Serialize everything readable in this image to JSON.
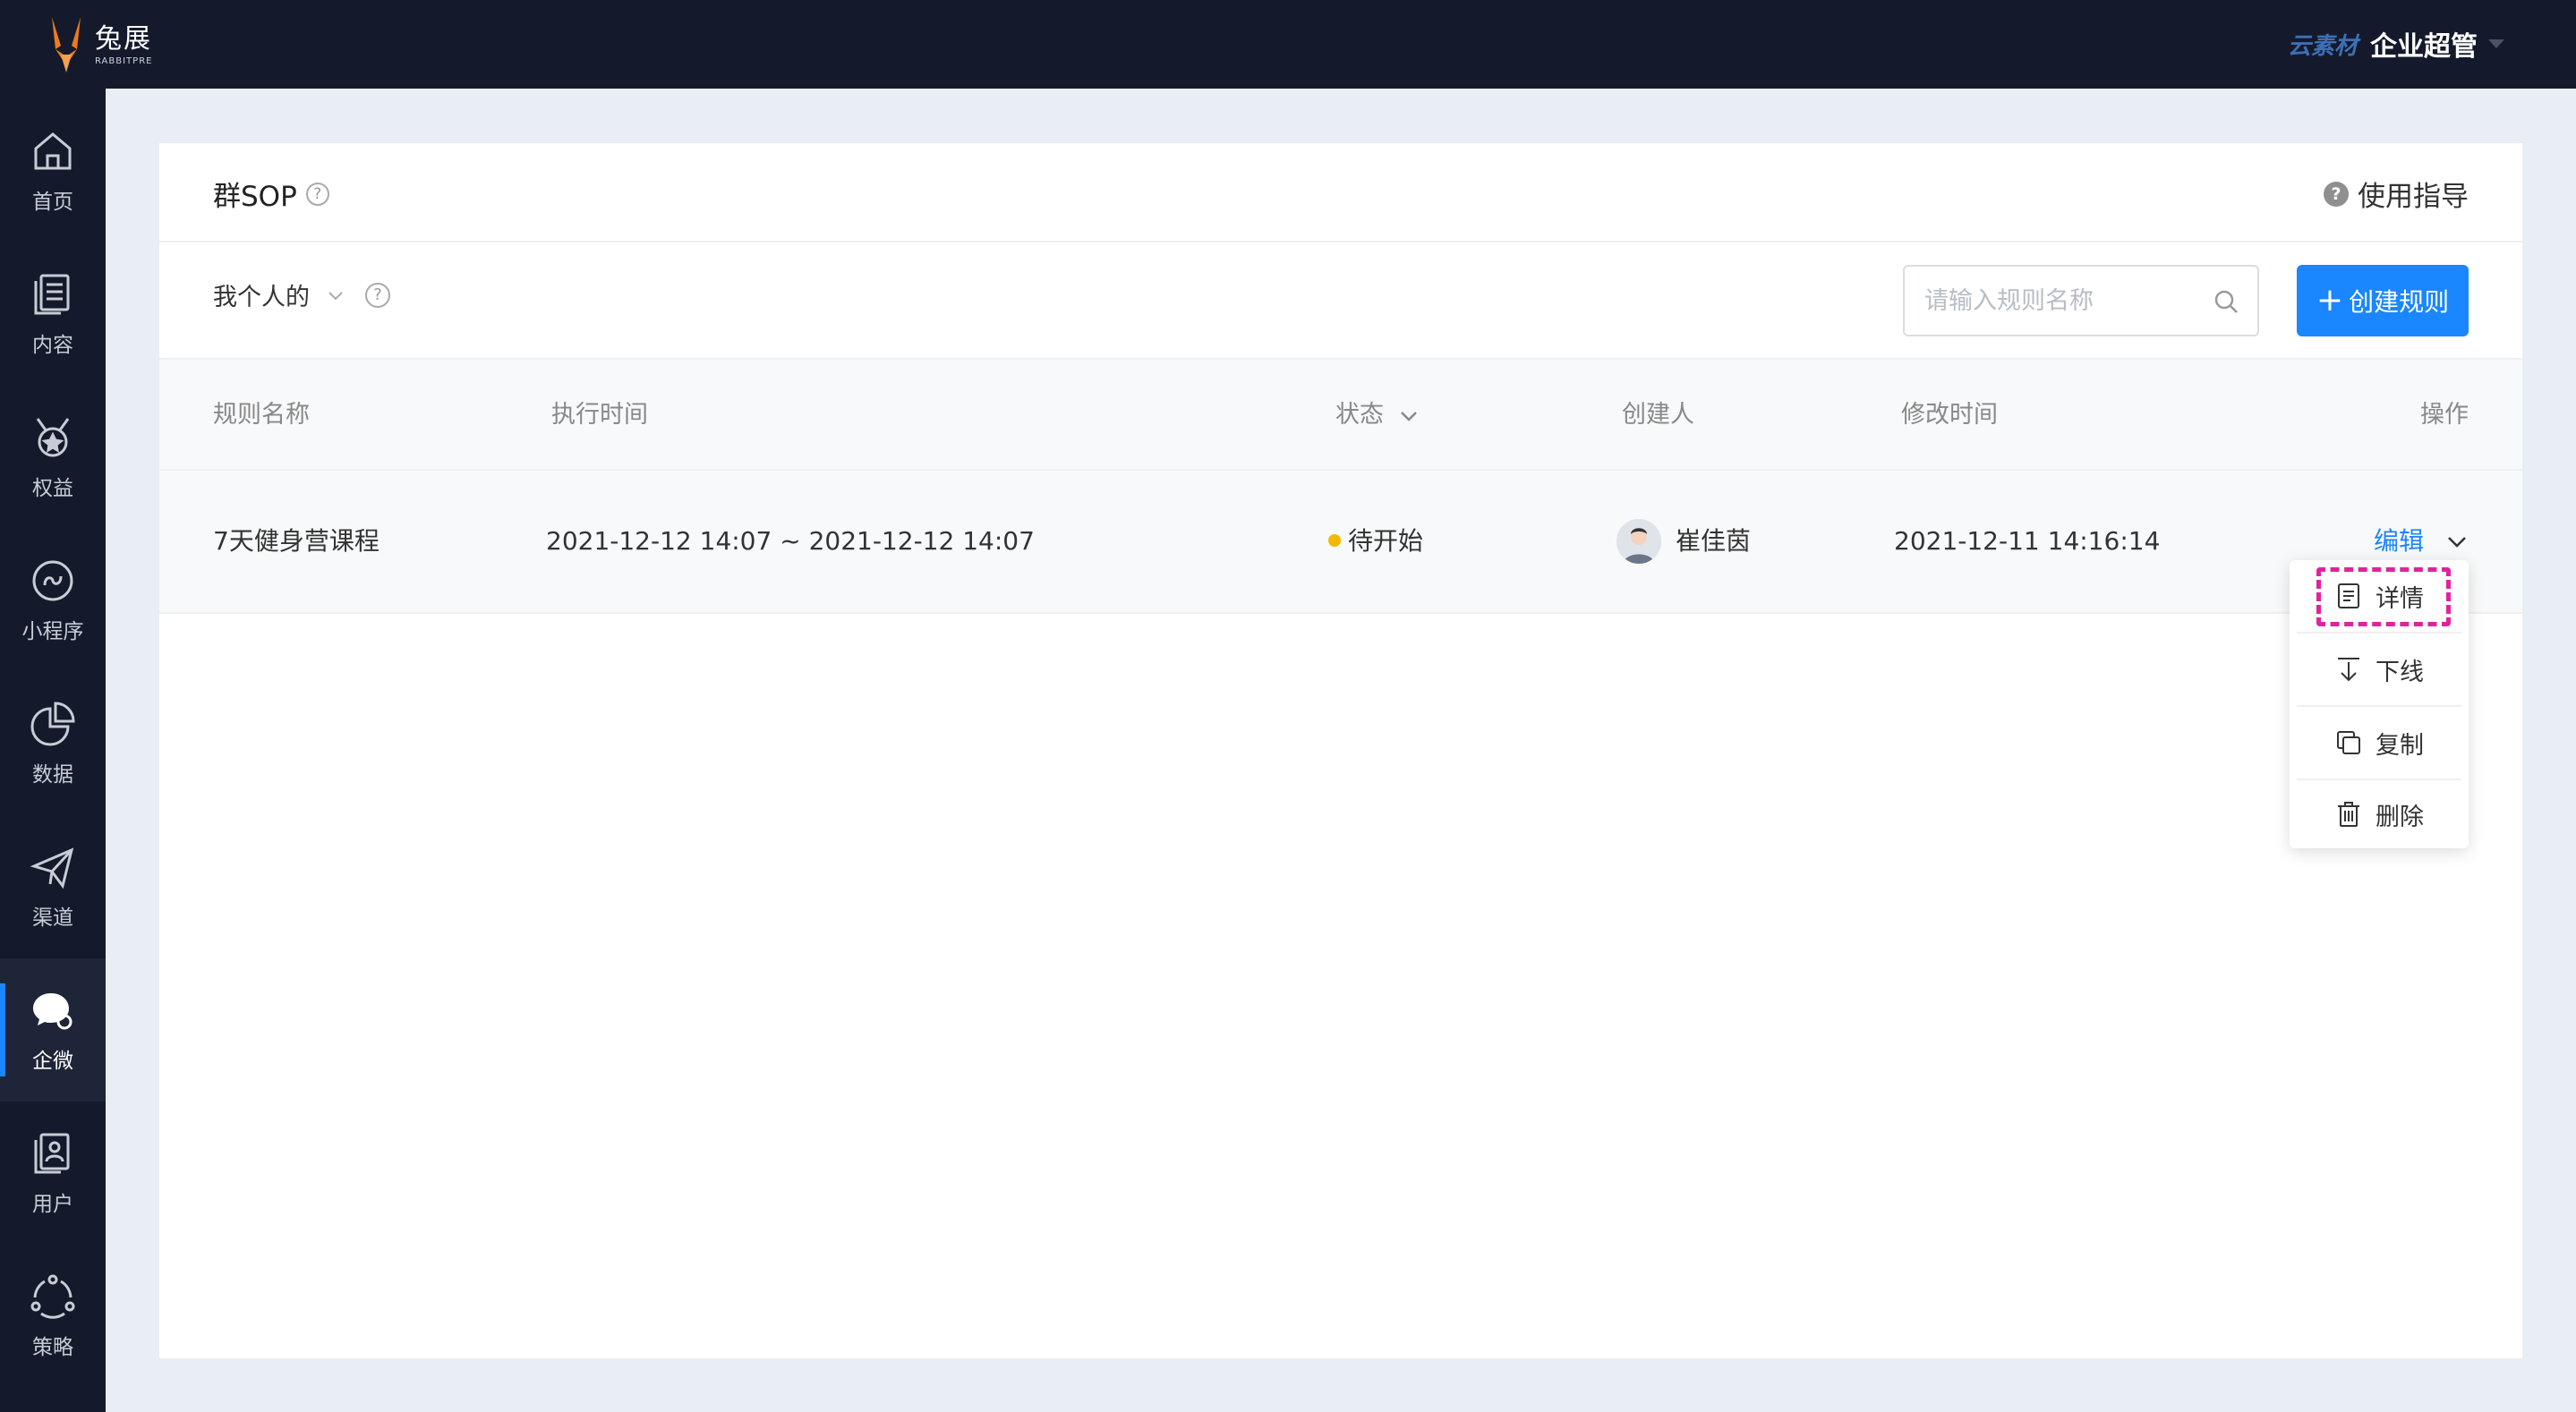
{
  "app": {
    "logo_cn": "兔展",
    "logo_en": "RABBITPRE",
    "top_brand": "云素材",
    "top_user": "企业超管"
  },
  "sidebar": {
    "items": [
      {
        "label": "首页",
        "icon": "home-icon"
      },
      {
        "label": "内容",
        "icon": "content-icon"
      },
      {
        "label": "权益",
        "icon": "medal-icon"
      },
      {
        "label": "小程序",
        "icon": "miniprogram-icon"
      },
      {
        "label": "数据",
        "icon": "pie-chart-icon"
      },
      {
        "label": "渠道",
        "icon": "paper-plane-icon"
      },
      {
        "label": "企微",
        "icon": "wecom-chat-icon"
      },
      {
        "label": "用户",
        "icon": "user-card-icon"
      },
      {
        "label": "策略",
        "icon": "strategy-icon"
      }
    ],
    "active": "企微"
  },
  "page": {
    "title": "群SOP",
    "help_glyph": "?",
    "guide": "使用指导"
  },
  "toolbar": {
    "filter_label": "我个人的",
    "search_placeholder": "请输入规则名称",
    "search_value": "",
    "create_label": "创建规则",
    "create_plus": "+"
  },
  "table": {
    "columns": [
      "规则名称",
      "执行时间",
      "状态",
      "创建人",
      "修改时间",
      "操作"
    ],
    "rows": [
      {
        "name": "7天健身营课程",
        "exec_time": "2021-12-12 14:07 ~ 2021-12-12 14:07",
        "status": "待开始",
        "status_color": "#f5b700",
        "creator": "崔佳茵",
        "modified": "2021-12-11 14:16:14",
        "action": "编辑"
      }
    ]
  },
  "dropdown": {
    "items": [
      {
        "label": "详情",
        "icon": "document-icon"
      },
      {
        "label": "下线",
        "icon": "arrow-down-to-line-icon"
      },
      {
        "label": "复制",
        "icon": "copy-icon"
      },
      {
        "label": "删除",
        "icon": "trash-icon"
      }
    ],
    "highlighted": "详情"
  },
  "colors": {
    "primary": "#1a86ff",
    "nav_bg": "#141a2b",
    "page_bg": "#e9edf4",
    "highlight": "#e0239d"
  }
}
